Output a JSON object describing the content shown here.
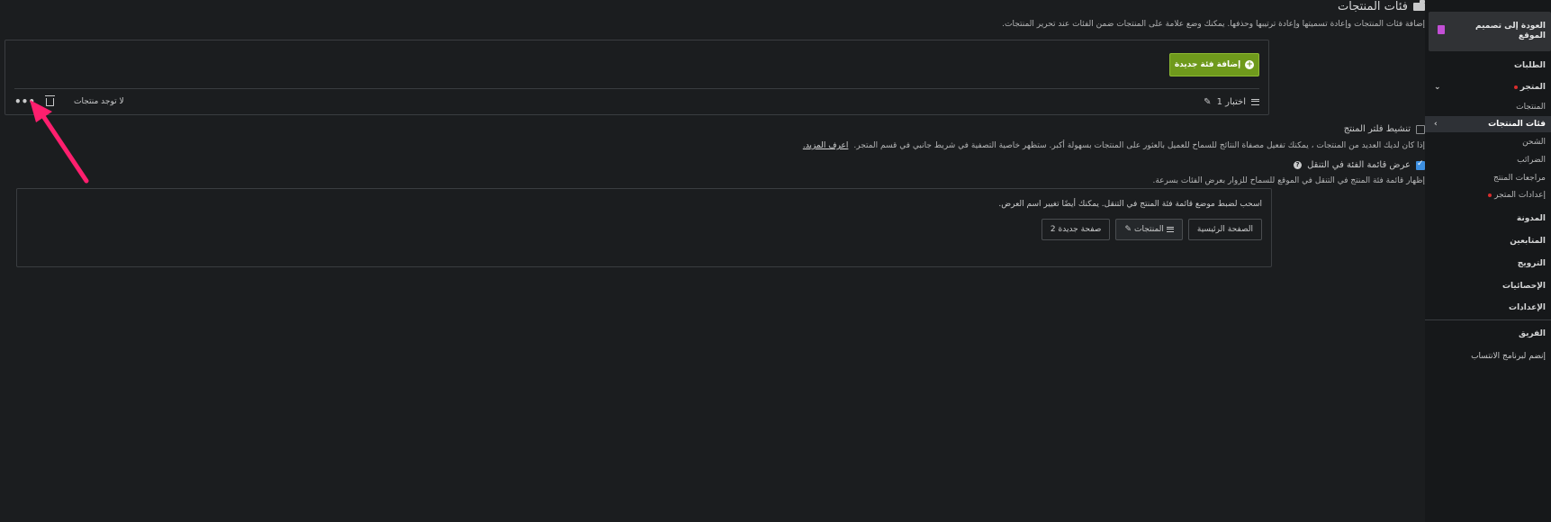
{
  "page": {
    "title": "فئات المنتجات",
    "description": "إضافة فئات المنتجات وإعادة تسميتها وإعادة ترتيبها وحذفها. يمكنك وضع علامة على المنتجات ضمن الفئات عند تحرير المنتجات."
  },
  "categories": {
    "add_button": "إضافة فئة جديدة",
    "row": {
      "name": "اختبار 1",
      "products": "لا توجد منتجات"
    }
  },
  "options": {
    "filter": {
      "label": "تنشيط فلتر المنتج",
      "checked": false,
      "help": "إذا كان لديك العديد من المنتجات ، يمكنك تفعيل مصفاة النتائج للسماح للعميل بالعثور على المنتجات بسهولة أكبر. ستظهر خاصية التصفية في شريط جانبي في قسم المتجر.",
      "learn_more": "اعرف المزيد."
    },
    "navigation": {
      "label": "عرض قائمة الفئة في التنقل",
      "checked": true,
      "help": "إظهار قائمة فئة المنتج في التنقل في الموقع للسماح للزوار بعرض الفئات بسرعة."
    }
  },
  "nav_order": {
    "description": "اسحب لضبط موضع قائمة فئة المنتج في التنقل. يمكنك أيضًا تغيير اسم العرض.",
    "items": [
      "الصفحة الرئيسية",
      "المنتجات",
      "صفحة جديدة 2"
    ]
  },
  "sidebar": {
    "back_label": "العودة إلى تصميم الموقع",
    "items": {
      "orders": "الطلبات",
      "store": "المتجر",
      "products": "المنتجات",
      "product_categories": "فئات المنتجات",
      "shipping": "الشحن",
      "taxes": "الضرائب",
      "product_reviews": "مراجعات المنتج",
      "store_settings": "إعدادات المتجر",
      "blog": "المدونة",
      "followers": "المتابعين",
      "promotion": "الترويج",
      "statistics": "الإحصائيات",
      "settings": "الإعدادات",
      "team": "الفريق",
      "affiliate": "إنضم لبرنامج الانتساب"
    }
  },
  "colors": {
    "background": "#1b1d1f",
    "sidebar": "#16181a",
    "primary_button": "#6f9a1c",
    "arrow": "#ff1f6e"
  }
}
